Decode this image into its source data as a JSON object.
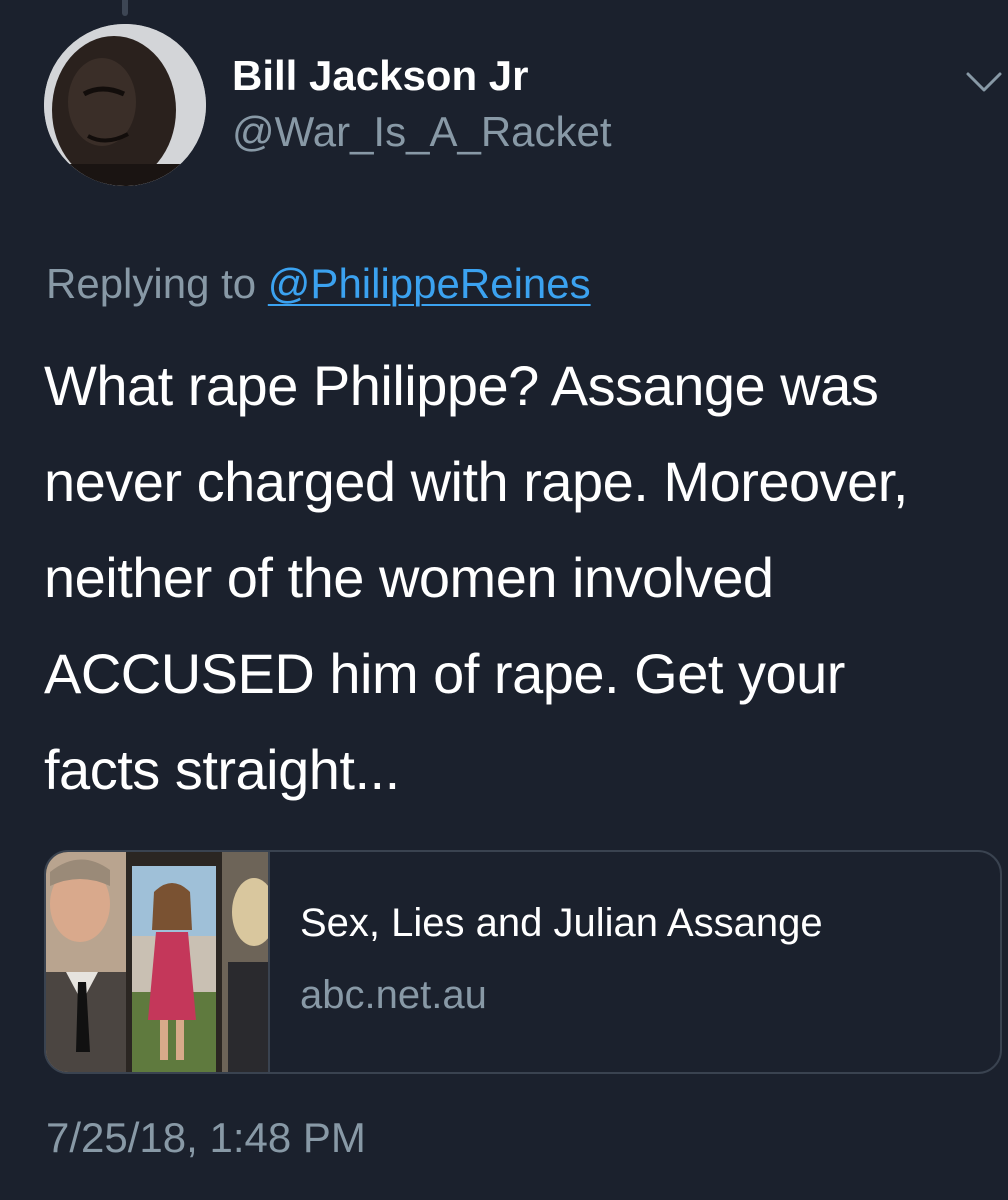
{
  "tweet": {
    "author": {
      "display_name": "Bill Jackson Jr",
      "handle": "@War_Is_A_Racket",
      "avatar_icon": "avatar-photo"
    },
    "menu_icon": "chevron-down-icon",
    "reply": {
      "prefix": "Replying to ",
      "mention": "@PhilippeReines"
    },
    "text_lines": [
      "What rape Philippe? Assange was",
      "never charged with rape. Moreover,",
      "neither of the women involved",
      "ACCUSED him of rape. Get your",
      "facts straight..."
    ],
    "link_card": {
      "title": "Sex, Lies and Julian Assange",
      "domain": "abc.net.au",
      "thumbnail_icon": "link-thumbnail-photo"
    },
    "timestamp": "7/25/18, 1:48 PM"
  },
  "colors": {
    "background": "#1b212d",
    "text_primary": "#ffffff",
    "text_secondary": "#8899a6",
    "link": "#3ba2f0",
    "border": "#3a4350"
  }
}
